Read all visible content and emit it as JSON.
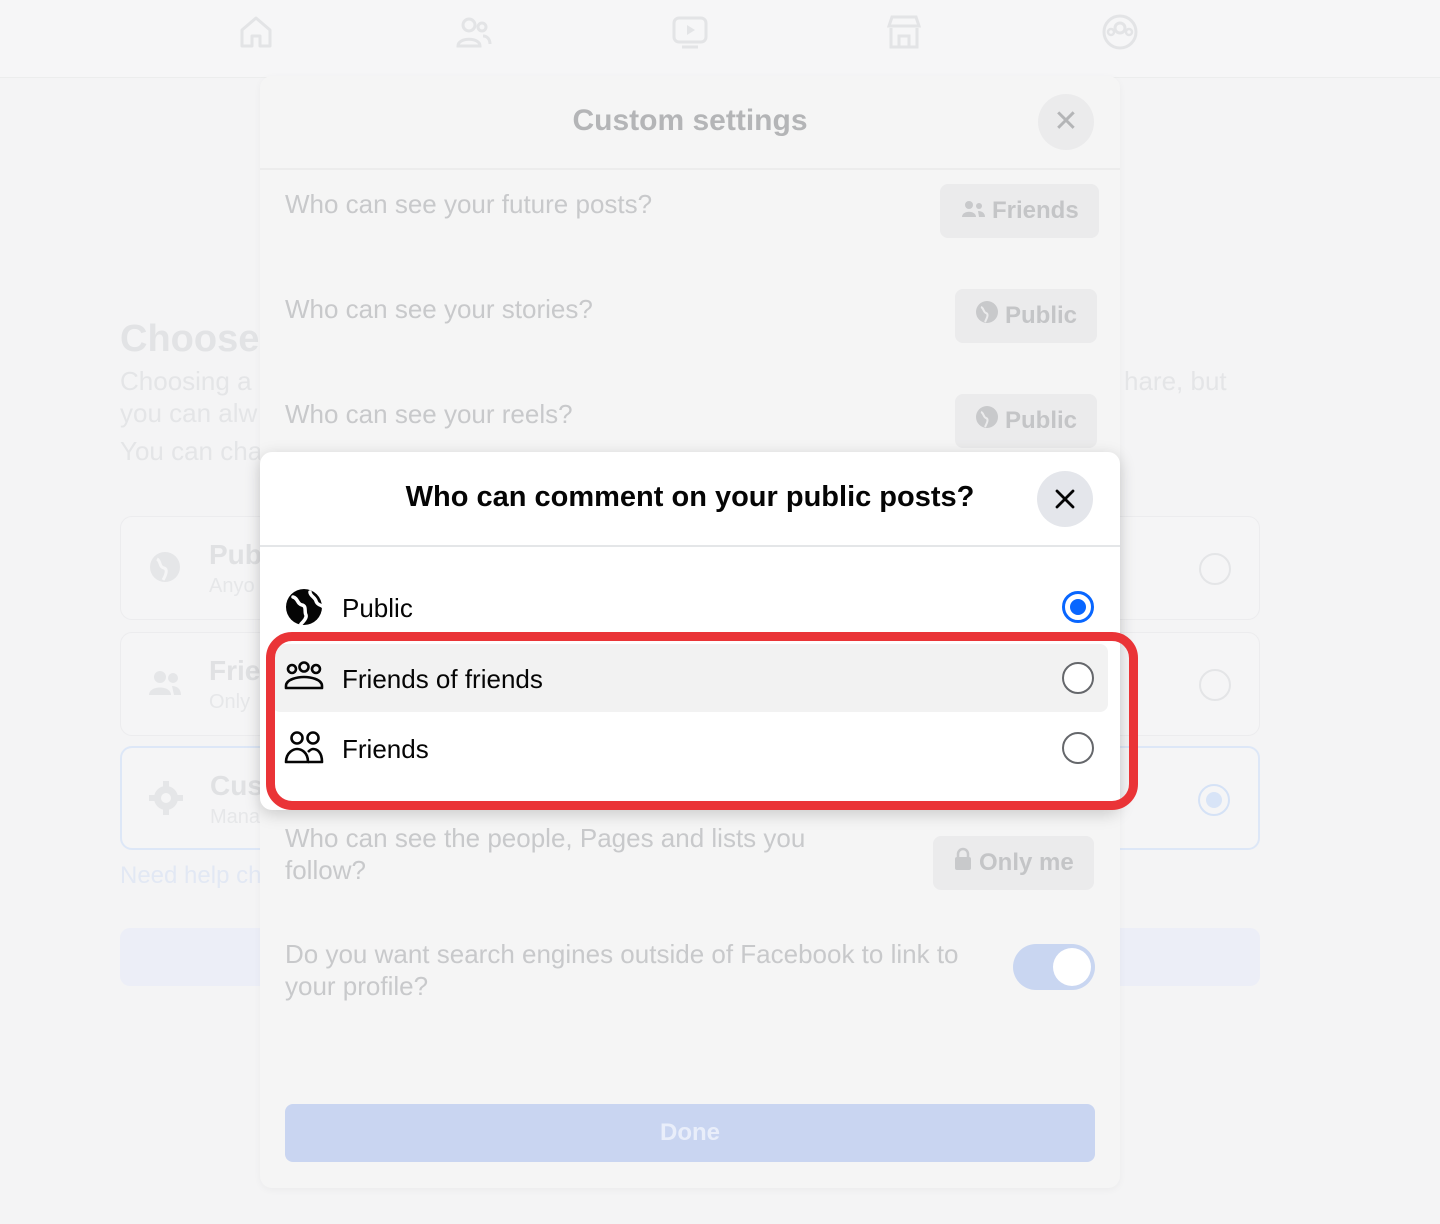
{
  "top_nav": {
    "icons": [
      "home-icon",
      "friends-icon",
      "video-icon",
      "marketplace-icon",
      "groups-icon"
    ]
  },
  "background_page": {
    "heading": "Choose",
    "desc_left_1": "Choosing a",
    "desc_left_2": "you can alw",
    "desc_left_3": "You can cha",
    "desc_right_1": "hare, but",
    "cards": [
      {
        "icon": "globe-icon",
        "title": "Pub",
        "subtitle": "Anyo"
      },
      {
        "icon": "friends-icon",
        "title": "Frie",
        "subtitle": "Only"
      },
      {
        "icon": "gear-icon",
        "title": "Cus",
        "subtitle": "Mana"
      }
    ],
    "help_link": "Need help ch"
  },
  "custom_settings": {
    "title": "Custom settings",
    "close": "✕",
    "rows": [
      {
        "question": "Who can see your future posts?",
        "value": "Friends",
        "icon": "friends-icon"
      },
      {
        "question": "Who can see your stories?",
        "value": "Public",
        "icon": "globe-icon"
      },
      {
        "question": "Who can see your reels?",
        "value": "Public",
        "icon": "globe-icon"
      },
      {
        "question_line1": "Who can see the people, Pages and lists you",
        "question_line2": "follow?",
        "value": "Only me",
        "icon": "lock-icon"
      },
      {
        "question_line1": "Do you want search engines outside of Facebook to link to",
        "question_line2": "your profile?",
        "toggle_on": true
      }
    ],
    "done_label": "Done"
  },
  "dialog": {
    "title": "Who can comment on your public posts?",
    "options": [
      {
        "label": "Public",
        "icon": "globe-icon",
        "selected": true
      },
      {
        "label": "Friends of friends",
        "icon": "friends-of-friends-icon",
        "selected": false
      },
      {
        "label": "Friends",
        "icon": "friends-icon",
        "selected": false
      }
    ]
  },
  "colors": {
    "accent": "#0866ff",
    "highlight": "#ea3437",
    "done_button": "#c9d5f1"
  }
}
